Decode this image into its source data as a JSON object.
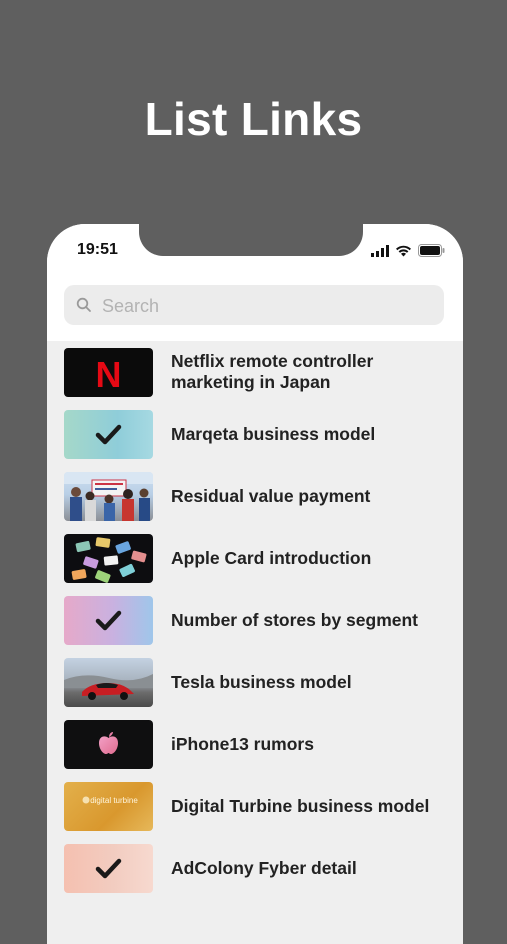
{
  "promo": {
    "title": "List Links"
  },
  "status_bar": {
    "time": "19:51"
  },
  "search": {
    "placeholder": "Search"
  },
  "items": [
    {
      "label": "Netflix remote controller marketing in Japan",
      "thumb": "netflix"
    },
    {
      "label": "Marqeta business model",
      "thumb": "check-teal"
    },
    {
      "label": "Residual value payment",
      "thumb": "photo-people"
    },
    {
      "label": "Apple Card introduction",
      "thumb": "photo-cards"
    },
    {
      "label": "Number of stores by segment",
      "thumb": "check-pink"
    },
    {
      "label": "Tesla business model",
      "thumb": "photo-car"
    },
    {
      "label": "iPhone13 rumors",
      "thumb": "photo-apple"
    },
    {
      "label": "Digital Turbine business model",
      "thumb": "photo-turbine"
    },
    {
      "label": "AdColony Fyber detail",
      "thumb": "check-peach"
    }
  ],
  "thumb_text": {
    "netflix_logo": "N",
    "turbine": "digital turbine"
  },
  "colors": {
    "background": "#5f5f5f",
    "list_background": "#efefef",
    "netflix_red": "#e50914"
  }
}
